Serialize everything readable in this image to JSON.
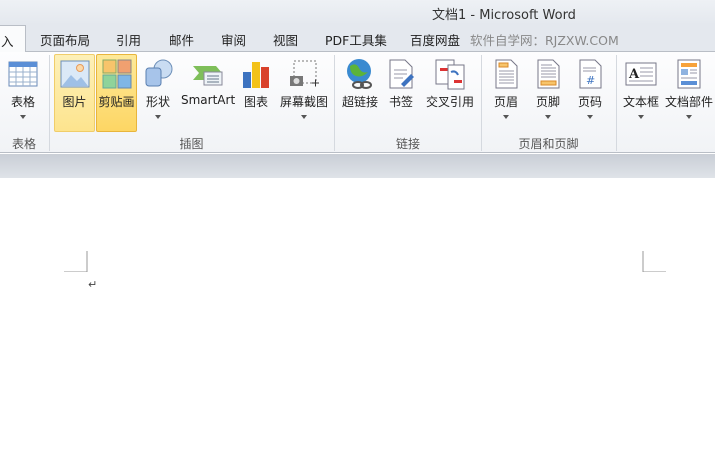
{
  "window": {
    "title": "文档1  -  Microsoft Word"
  },
  "tabs": [
    {
      "label": "插入",
      "visible": "入",
      "active": true
    },
    {
      "label": "页面布局"
    },
    {
      "label": "引用"
    },
    {
      "label": "邮件"
    },
    {
      "label": "审阅"
    },
    {
      "label": "视图"
    },
    {
      "label": "PDF工具集"
    },
    {
      "label": "百度网盘"
    }
  ],
  "watermark": "软件自学网：RJZXW.COM",
  "groups": {
    "table": "表格",
    "illustrations": "插图",
    "links": "链接",
    "header_footer": "页眉和页脚"
  },
  "buttons": {
    "table": "表格",
    "picture": "图片",
    "clipart": "剪贴画",
    "shapes": "形状",
    "smartart": "SmartArt",
    "chart": "图表",
    "screenshot": "屏幕截图",
    "hyperlink": "超链接",
    "bookmark": "书签",
    "crossref": "交叉引用",
    "header": "页眉",
    "footer": "页脚",
    "pagenum": "页码",
    "textbox": "文本框",
    "quickparts": "文档部件"
  },
  "document": {
    "paragraph_mark": "↵"
  }
}
